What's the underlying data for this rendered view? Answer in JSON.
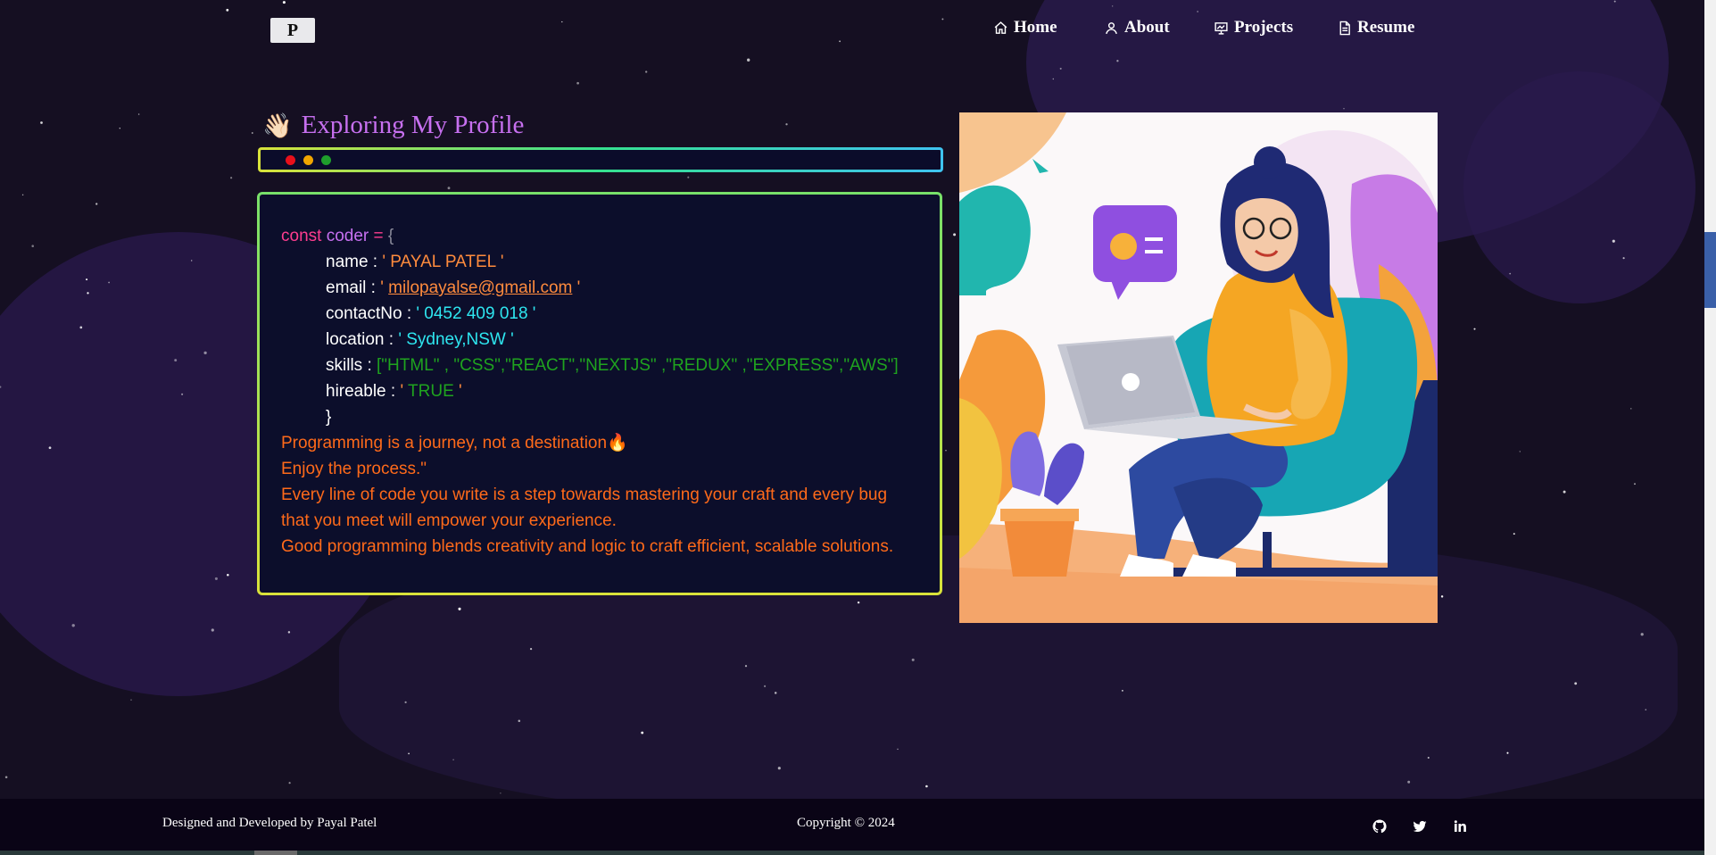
{
  "nav": {
    "logo_letter": "P",
    "items": [
      {
        "label": "Home",
        "icon": "home-icon"
      },
      {
        "label": "About",
        "icon": "user-icon"
      },
      {
        "label": "Projects",
        "icon": "presentation-icon"
      },
      {
        "label": "Resume",
        "icon": "document-icon"
      }
    ]
  },
  "profile": {
    "wave_emoji": "👋🏻",
    "title": "Exploring My Profile"
  },
  "code": {
    "const_kw": "const",
    "var_name": "coder",
    "assign": "=",
    "open_brace": "{",
    "name_key": "name :",
    "name_val": "' PAYAL PATEL '",
    "email_key": "email :",
    "email_q1": "'",
    "email_val": "milopayalse@gmail.com",
    "email_q2": "'",
    "contact_key": "contactNo :",
    "contact_val": "' 0452 409 018 '",
    "location_key": "location :",
    "location_val": "' Sydney,NSW '",
    "skills_key": "skills :",
    "skills_val": "[\"HTML\" , \"CSS\",\"REACT\",\"NEXTJS\" ,\"REDUX\" ,\"EXPRESS\",\"AWS\"]",
    "hireable_key": "hireable :",
    "hireable_q1": "'",
    "hireable_val": "TRUE",
    "hireable_q2": "'",
    "close_brace": "}",
    "quote1": "Programming is a journey, not a destination",
    "quote1_emoji": "🔥",
    "quote2": "Enjoy the process.\"",
    "quote3a": "Every line of code you write is a step towards mastering your craft and every bug",
    "quote3b": "that you meet will empower your experience.",
    "quote4": "Good programming blends creativity and logic to craft efficient, scalable solutions."
  },
  "footer": {
    "credit": "Designed and Developed by Payal Patel",
    "copyright": "Copyright © 2024",
    "socials": [
      "github-icon",
      "twitter-icon",
      "linkedin-icon"
    ]
  },
  "colors": {
    "accent": "#c770f0",
    "background": "#150f22",
    "string": "#ff8b3d",
    "quote": "#ff6a1a"
  }
}
